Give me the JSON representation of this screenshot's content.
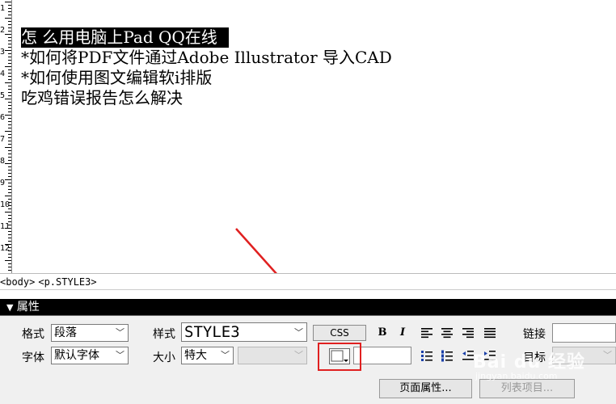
{
  "editor": {
    "lines": [
      "怎 么用电脑上Pad QQ在线",
      "*如何将PDF文件通过Adobe Illustrator 导入CAD",
      "*如何使用图文编辑软i排版",
      "吃鸡错误报告怎么解决"
    ]
  },
  "ruler": {
    "numbers": [
      "1",
      "2",
      "3",
      "4",
      "5",
      "6",
      "7",
      "8",
      "9",
      "10",
      "11",
      "12"
    ]
  },
  "tag_selector": {
    "tags": [
      "<body>",
      "<p.STYLE3>"
    ]
  },
  "properties": {
    "title": "属性",
    "format_label": "格式",
    "format_value": "段落",
    "style_label": "样式",
    "style_value": "STYLE3",
    "css_label": "CSS",
    "bold_label": "B",
    "italic_label": "I",
    "link_label": "链接",
    "font_label": "字体",
    "font_value": "默认字体",
    "size_label": "大小",
    "size_value": "特大",
    "target_label": "目标",
    "page_props_button": "页面属性...",
    "list_item_button": "列表项目..."
  },
  "watermark": {
    "brand": "Bai du 经验",
    "url": "jingyan.baidu.com"
  },
  "colors": {
    "highlight": "#e02020",
    "arrow": "#e02020",
    "panel_header": "#000000"
  }
}
